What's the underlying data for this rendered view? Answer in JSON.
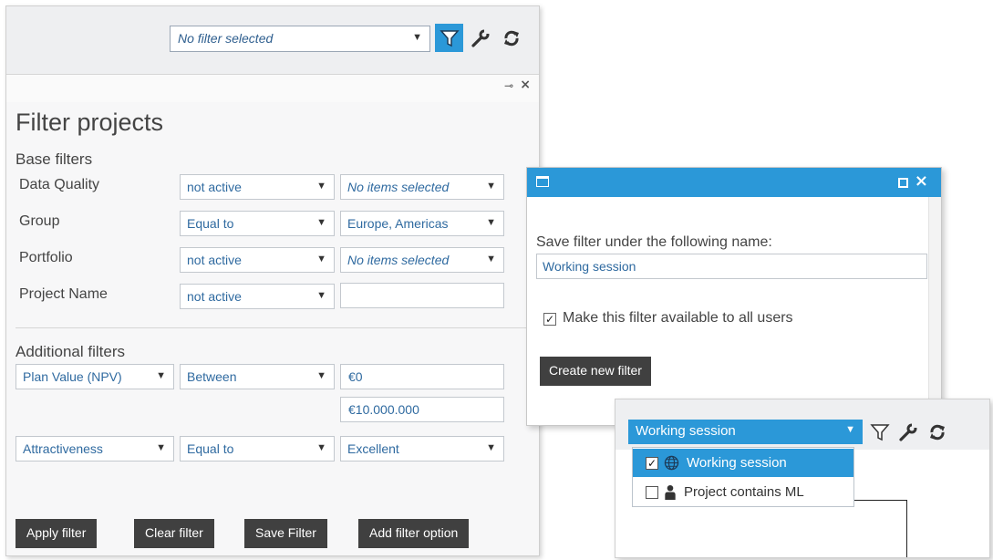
{
  "toolbar": {
    "filter_select_value": "No filter selected"
  },
  "filter_panel": {
    "title": "Filter projects",
    "base_filters_heading": "Base filters",
    "additional_filters_heading": "Additional filters",
    "base_rows": [
      {
        "label": "Data Quality",
        "operator": "not active",
        "value": "No items selected"
      },
      {
        "label": "Group",
        "operator": "Equal to",
        "value": "Europe, Americas"
      },
      {
        "label": "Portfolio",
        "operator": "not active",
        "value": "No items selected"
      },
      {
        "label": "Project Name",
        "operator": "not active",
        "value": ""
      }
    ],
    "additional_rows": [
      {
        "field": "Plan Value (NPV)",
        "operator": "Between",
        "value_from": "€0",
        "value_to": "€10.000.000"
      },
      {
        "field": "Attractiveness",
        "operator": "Equal to",
        "value": "Excellent"
      }
    ],
    "buttons": {
      "apply": "Apply filter",
      "clear": "Clear filter",
      "save": "Save Filter",
      "add_option": "Add filter option"
    }
  },
  "save_dialog": {
    "label": "Save filter under the following name:",
    "name_value": "Working session",
    "checkbox_label": "Make this filter available to all users",
    "checkbox_checked": true,
    "create_button": "Create new filter"
  },
  "dropdown": {
    "selected_value": "Working session",
    "options": [
      {
        "label": "Working session",
        "icon": "globe-icon",
        "checked": true
      },
      {
        "label": "Project contains ML",
        "icon": "person-icon",
        "checked": false
      }
    ]
  },
  "colors": {
    "accent": "#2b98d8",
    "button_dark": "#404040",
    "link_text": "#2f6aa0"
  }
}
